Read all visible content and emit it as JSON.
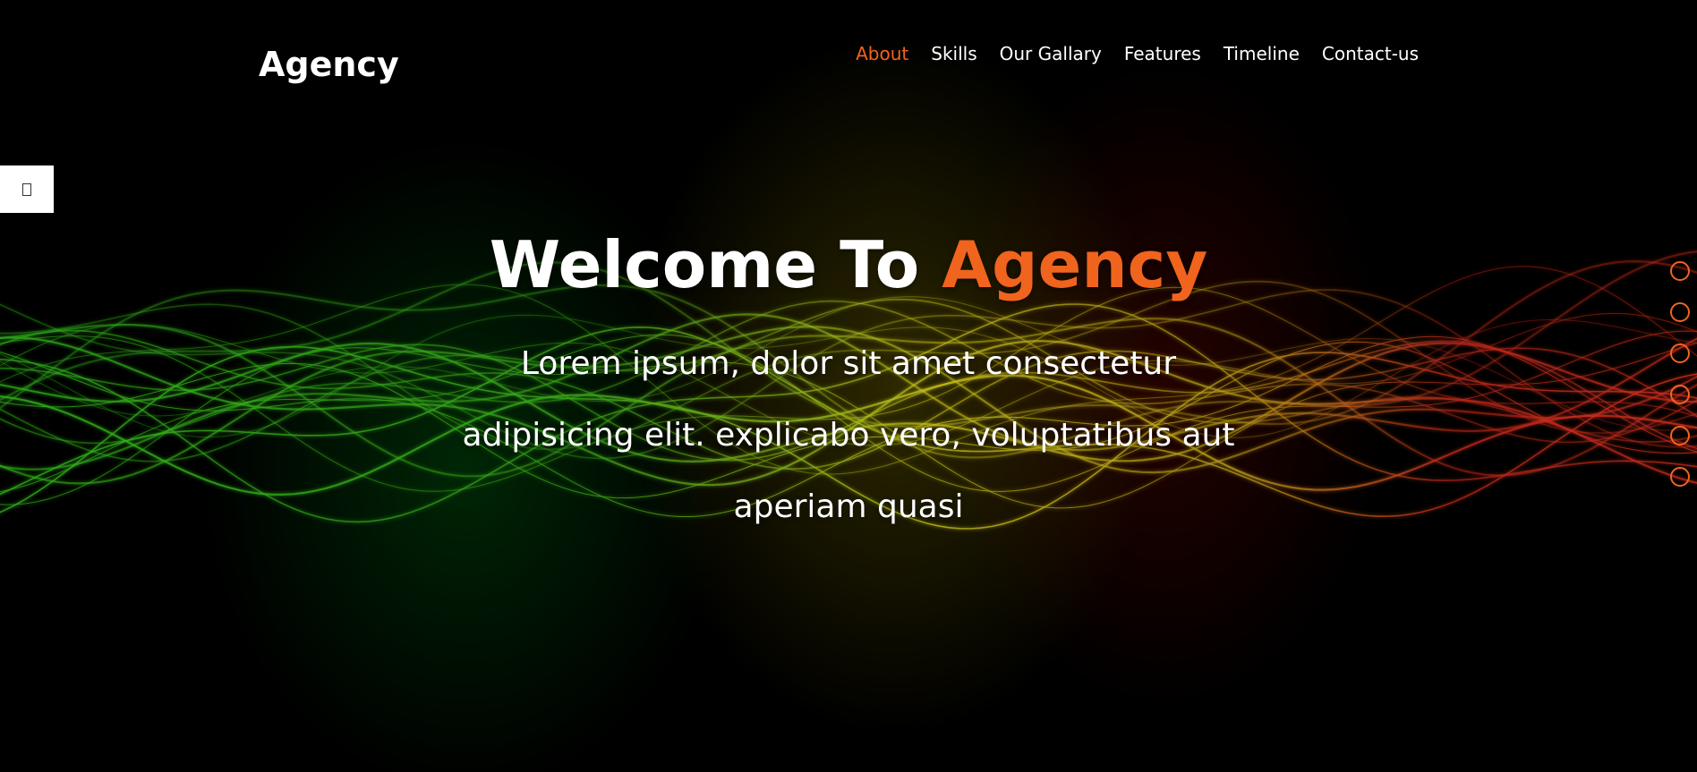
{
  "brand": {
    "logo": "Agency",
    "accent_color": "#f0641e"
  },
  "nav": {
    "items": [
      {
        "label": "About",
        "active": true
      },
      {
        "label": "Skills",
        "active": false
      },
      {
        "label": "Our Gallary",
        "active": false
      },
      {
        "label": "Features",
        "active": false
      },
      {
        "label": "Timeline",
        "active": false
      },
      {
        "label": "Contact-us",
        "active": false
      }
    ]
  },
  "settings_toggle": {
    "icon": "gear-icon"
  },
  "hero": {
    "title_prefix": "Welcome To",
    "title_accent": "Agency",
    "text": "Lorem ipsum, dolor sit amet consectetur adipisicing elit. explicabo vero, voluptatibus aut aperiam quasi"
  },
  "bullets": {
    "count": 6
  }
}
